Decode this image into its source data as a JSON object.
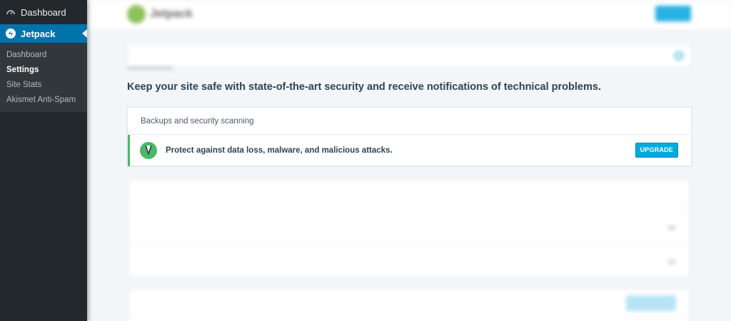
{
  "sidebar": {
    "dashboard_label": "Dashboard",
    "jetpack_label": "Jetpack",
    "submenu": [
      {
        "label": "Dashboard"
      },
      {
        "label": "Settings"
      },
      {
        "label": "Site Stats"
      },
      {
        "label": "Akismet Anti-Spam"
      }
    ]
  },
  "header": {
    "logo_text": "Jetpack"
  },
  "main": {
    "headline": "Keep your site safe with state-of-the-art security and receive notifications of technical problems.",
    "card": {
      "title": "Backups and security scanning",
      "body": "Protect against data loss, malware, and malicious attacks.",
      "upgrade_label": "UPGRADE"
    }
  },
  "colors": {
    "accent": "#0073aa",
    "success": "#4ab866",
    "button": "#00aadc"
  }
}
